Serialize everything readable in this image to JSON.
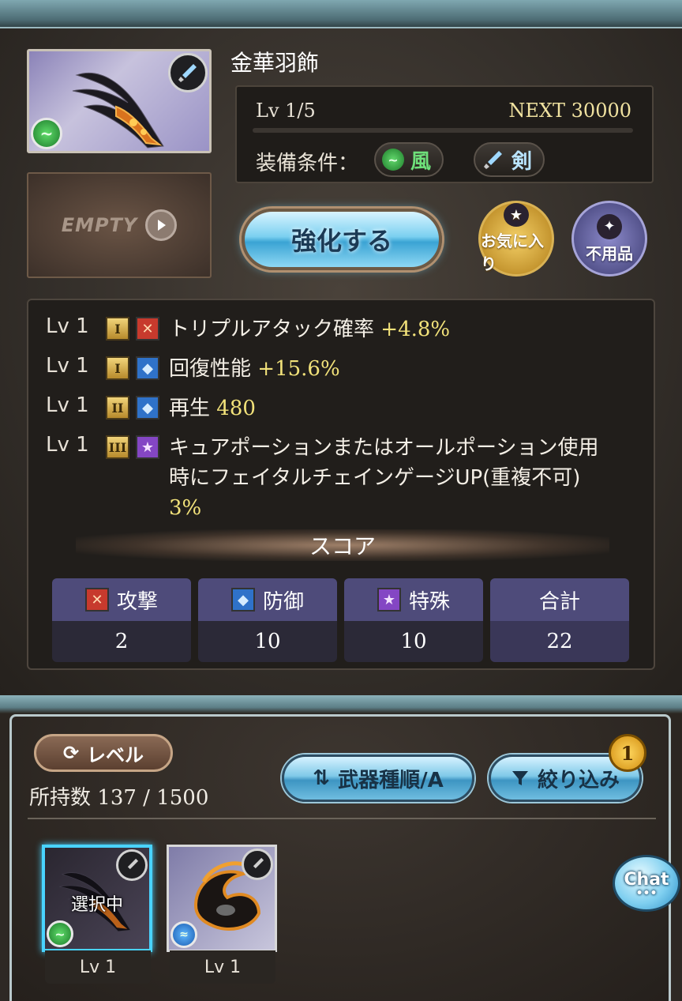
{
  "weapon": {
    "name": "金華羽飾",
    "level": "Lv 1/5",
    "next_exp": "NEXT 30000",
    "equip_condition_label": "装備条件：",
    "element": "風",
    "weapon_type": "剣",
    "secondary_slot": "EMPTY"
  },
  "actions": {
    "enhance": "強化する",
    "favorite": "お気に入り",
    "unwanted": "不用品"
  },
  "skills": [
    {
      "lv": "Lv 1",
      "rank": "I",
      "type": "attack",
      "text": "トリプルアタック確率",
      "value": "+4.8%"
    },
    {
      "lv": "Lv 1",
      "rank": "I",
      "type": "defense",
      "text": "回復性能",
      "value": "+15.6%"
    },
    {
      "lv": "Lv 1",
      "rank": "II",
      "type": "defense",
      "text": "再生",
      "value": "480"
    },
    {
      "lv": "Lv 1",
      "rank": "III",
      "type": "special",
      "text": "キュアポーションまたはオールポーション使用時にフェイタルチェインゲージUP(重複不可)",
      "value": "3%"
    }
  ],
  "score": {
    "title": "スコア",
    "columns": [
      {
        "label": "攻撃",
        "value": "2"
      },
      {
        "label": "防御",
        "value": "10"
      },
      {
        "label": "特殊",
        "value": "10"
      },
      {
        "label": "合計",
        "value": "22"
      }
    ]
  },
  "inventory": {
    "sort_level_label": "レベル",
    "count_label": "所持数",
    "count_value": "137 / 1500",
    "sort_type_label": "武器種順/A",
    "filter_label": "絞り込み",
    "filter_count": "1",
    "selected_label": "選択中",
    "items": [
      {
        "level": "Lv 1",
        "element": "wind",
        "selected": true
      },
      {
        "level": "Lv 1",
        "element": "water",
        "selected": false
      }
    ]
  },
  "chat": {
    "label": "Chat",
    "dots": "•••"
  },
  "colors": {
    "accent_blue": "#49d3ff",
    "value_yellow": "#f2e27a",
    "score_header": "#4e4b7a",
    "favorite_gold": "#f3cf66",
    "unwanted_purple": "#8b89c9"
  },
  "icons": [
    "sword-icon",
    "wind-element-icon",
    "play-icon",
    "star-icon",
    "sparkle-icon",
    "attack-icon",
    "shield-icon",
    "special-star-icon",
    "refresh-icon",
    "sort-arrows-icon",
    "filter-funnel-icon",
    "water-element-icon"
  ]
}
